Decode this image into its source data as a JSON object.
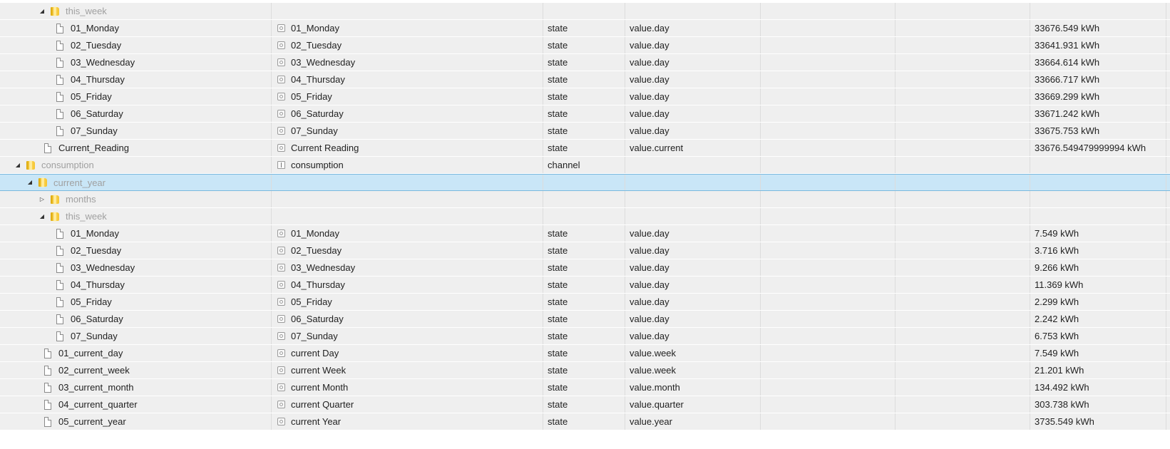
{
  "icons": {
    "folder": "folder-icon",
    "file": "file-icon",
    "state": "state-icon",
    "channel": "channel-icon",
    "expanded": "triangle-expanded-icon",
    "collapsed": "triangle-collapsed-icon"
  },
  "colors": {
    "row_background": "#efefef",
    "selected_background": "#c9e6f7",
    "selected_border": "#7ab9de",
    "folder_text": "#a0a0a0"
  },
  "rows": [
    {
      "kind": "folder",
      "depth": 2,
      "toggle": "expanded",
      "id": "this_week",
      "name": "",
      "type": "",
      "role": "",
      "value": ""
    },
    {
      "kind": "state",
      "depth": 3,
      "id": "01_Monday",
      "name": "01_Monday",
      "type": "state",
      "role": "value.day",
      "value": "33676.549 kWh"
    },
    {
      "kind": "state",
      "depth": 3,
      "id": "02_Tuesday",
      "name": "02_Tuesday",
      "type": "state",
      "role": "value.day",
      "value": "33641.931 kWh"
    },
    {
      "kind": "state",
      "depth": 3,
      "id": "03_Wednesday",
      "name": "03_Wednesday",
      "type": "state",
      "role": "value.day",
      "value": "33664.614 kWh"
    },
    {
      "kind": "state",
      "depth": 3,
      "id": "04_Thursday",
      "name": "04_Thursday",
      "type": "state",
      "role": "value.day",
      "value": "33666.717 kWh"
    },
    {
      "kind": "state",
      "depth": 3,
      "id": "05_Friday",
      "name": "05_Friday",
      "type": "state",
      "role": "value.day",
      "value": "33669.299 kWh"
    },
    {
      "kind": "state",
      "depth": 3,
      "id": "06_Saturday",
      "name": "06_Saturday",
      "type": "state",
      "role": "value.day",
      "value": "33671.242 kWh"
    },
    {
      "kind": "state",
      "depth": 3,
      "id": "07_Sunday",
      "name": "07_Sunday",
      "type": "state",
      "role": "value.day",
      "value": "33675.753 kWh"
    },
    {
      "kind": "state",
      "depth": 2,
      "id": "Current_Reading",
      "name": "Current Reading",
      "type": "state",
      "role": "value.current",
      "value": "33676.549479999994 kWh"
    },
    {
      "kind": "channel",
      "depth": 0,
      "toggle": "expanded",
      "id": "consumption",
      "name": "consumption",
      "type": "channel",
      "role": "",
      "value": ""
    },
    {
      "kind": "folder",
      "depth": 1,
      "toggle": "expanded",
      "id": "current_year",
      "name": "",
      "type": "",
      "role": "",
      "value": "",
      "selected": true
    },
    {
      "kind": "folder",
      "depth": 2,
      "toggle": "collapsed",
      "id": "months",
      "name": "",
      "type": "",
      "role": "",
      "value": ""
    },
    {
      "kind": "folder",
      "depth": 2,
      "toggle": "expanded",
      "id": "this_week",
      "name": "",
      "type": "",
      "role": "",
      "value": ""
    },
    {
      "kind": "state",
      "depth": 3,
      "id": "01_Monday",
      "name": "01_Monday",
      "type": "state",
      "role": "value.day",
      "value": "7.549 kWh"
    },
    {
      "kind": "state",
      "depth": 3,
      "id": "02_Tuesday",
      "name": "02_Tuesday",
      "type": "state",
      "role": "value.day",
      "value": "3.716 kWh"
    },
    {
      "kind": "state",
      "depth": 3,
      "id": "03_Wednesday",
      "name": "03_Wednesday",
      "type": "state",
      "role": "value.day",
      "value": "9.266 kWh"
    },
    {
      "kind": "state",
      "depth": 3,
      "id": "04_Thursday",
      "name": "04_Thursday",
      "type": "state",
      "role": "value.day",
      "value": "11.369 kWh"
    },
    {
      "kind": "state",
      "depth": 3,
      "id": "05_Friday",
      "name": "05_Friday",
      "type": "state",
      "role": "value.day",
      "value": "2.299 kWh"
    },
    {
      "kind": "state",
      "depth": 3,
      "id": "06_Saturday",
      "name": "06_Saturday",
      "type": "state",
      "role": "value.day",
      "value": "2.242 kWh"
    },
    {
      "kind": "state",
      "depth": 3,
      "id": "07_Sunday",
      "name": "07_Sunday",
      "type": "state",
      "role": "value.day",
      "value": "6.753 kWh"
    },
    {
      "kind": "state",
      "depth": 2,
      "id": "01_current_day",
      "name": "current Day",
      "type": "state",
      "role": "value.week",
      "value": "7.549 kWh"
    },
    {
      "kind": "state",
      "depth": 2,
      "id": "02_current_week",
      "name": "current Week",
      "type": "state",
      "role": "value.week",
      "value": "21.201 kWh"
    },
    {
      "kind": "state",
      "depth": 2,
      "id": "03_current_month",
      "name": "current Month",
      "type": "state",
      "role": "value.month",
      "value": "134.492 kWh"
    },
    {
      "kind": "state",
      "depth": 2,
      "id": "04_current_quarter",
      "name": "current Quarter",
      "type": "state",
      "role": "value.quarter",
      "value": "303.738 kWh"
    },
    {
      "kind": "state",
      "depth": 2,
      "id": "05_current_year",
      "name": "current Year",
      "type": "state",
      "role": "value.year",
      "value": "3735.549 kWh"
    }
  ]
}
